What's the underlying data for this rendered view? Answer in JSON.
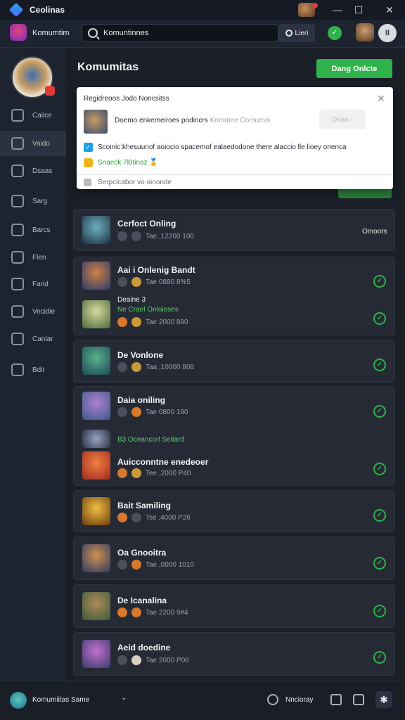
{
  "titlebar": {
    "app_name": "Ceolinas",
    "controls": {
      "minimize": "—",
      "maximize": "☐",
      "close": "✕"
    }
  },
  "topbar": {
    "brand": "Komumtim",
    "search": {
      "value": "Komuntinnes",
      "placeholder": ""
    },
    "search_button": "Lieri",
    "status_icon": "✓",
    "pause_icon": "II"
  },
  "sidebar": {
    "items": [
      {
        "label": "Cailce",
        "icon": "chat-icon"
      },
      {
        "label": "Vaido",
        "icon": "message-icon"
      },
      {
        "label": "Dsaas",
        "icon": "grid-icon"
      },
      {
        "label": "Sarg",
        "icon": "search-icon"
      },
      {
        "label": "Barcs",
        "icon": "library-icon"
      },
      {
        "label": "Flen",
        "icon": "puzzle-icon"
      },
      {
        "label": "Farid",
        "icon": "list-icon"
      },
      {
        "label": "Vecidie",
        "icon": "shield-icon"
      },
      {
        "label": "Canlar",
        "icon": "screen-icon"
      },
      {
        "label": "Bdit",
        "icon": "gear-icon"
      }
    ]
  },
  "main": {
    "title": "Komumitas",
    "cta": "Dang Onlcte"
  },
  "popup": {
    "title": "Regidreoos Jodo Noncsitss",
    "close": "✕",
    "description": "Doemo enkemeiroes podincrs",
    "description_muted": "Komntee Comurnis",
    "button": "Deao ›",
    "checkbox_label": "Scoinic:khesuunof aoiocio spacemof ealaedodone there alaccio lle lioey onenca",
    "lock_label": "Snaeck 7l0tinaz 🏅",
    "footer": "Serpclcabor vo oinonde"
  },
  "rows": [
    {
      "name": "Cerfoct Onling",
      "meta": "Tae ,12200 100",
      "right": "Omoors"
    },
    {
      "name": "Aai i Onlenig Bandt",
      "meta": "Tae 0880 8%5"
    },
    {
      "name": "Deaine 3",
      "sub": "Ne Crael Onloieses",
      "meta": "Tae 2000 890"
    },
    {
      "name": "De Vonlone",
      "meta": "Taa ,10000 806"
    },
    {
      "name": "Daia oniling",
      "meta": "Tae 0800 190"
    },
    {
      "name": "Auicconntne enedeoer",
      "pre": "B3 Oceancorl Seitard",
      "meta": "Tee ,2000 P40"
    },
    {
      "name": "Bait Samiling",
      "meta": "Tse ,4000 P26"
    },
    {
      "name": "Oa Gnooitra",
      "meta": "Tae ,0000 1010"
    },
    {
      "name": "De Icanalina",
      "meta": "Tae 2200 9#4"
    },
    {
      "name": "Aeid doedine",
      "meta": "Tae 2000 P06"
    }
  ],
  "bottombar": {
    "label": "Komumiitas Same",
    "chevron": "⌄",
    "status": "Nncioray"
  }
}
